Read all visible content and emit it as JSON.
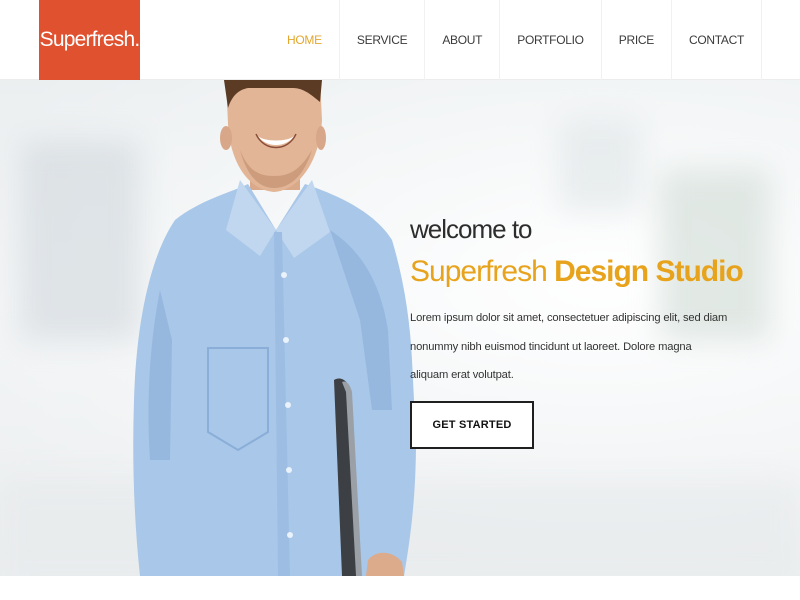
{
  "brand": {
    "logo_text": "Superfresh.",
    "accent_color": "#e0512f",
    "highlight_color": "#e8a31c"
  },
  "nav": {
    "items": [
      {
        "label": "HOME",
        "active": true
      },
      {
        "label": "SERVICE",
        "active": false
      },
      {
        "label": "ABOUT",
        "active": false
      },
      {
        "label": "PORTFOLIO",
        "active": false
      },
      {
        "label": "PRICE",
        "active": false
      },
      {
        "label": "CONTACT",
        "active": false
      }
    ]
  },
  "hero": {
    "welcome": "welcome to",
    "headline_light": "Superfresh",
    "headline_bold": "Design Studio",
    "description": "Lorem ipsum dolor sit amet, consectetuer adipiscing elit, sed diam nonummy nibh euismod tincidunt ut laoreet. Dolore magna aliquam erat volutpat.",
    "cta_label": "GET STARTED"
  }
}
